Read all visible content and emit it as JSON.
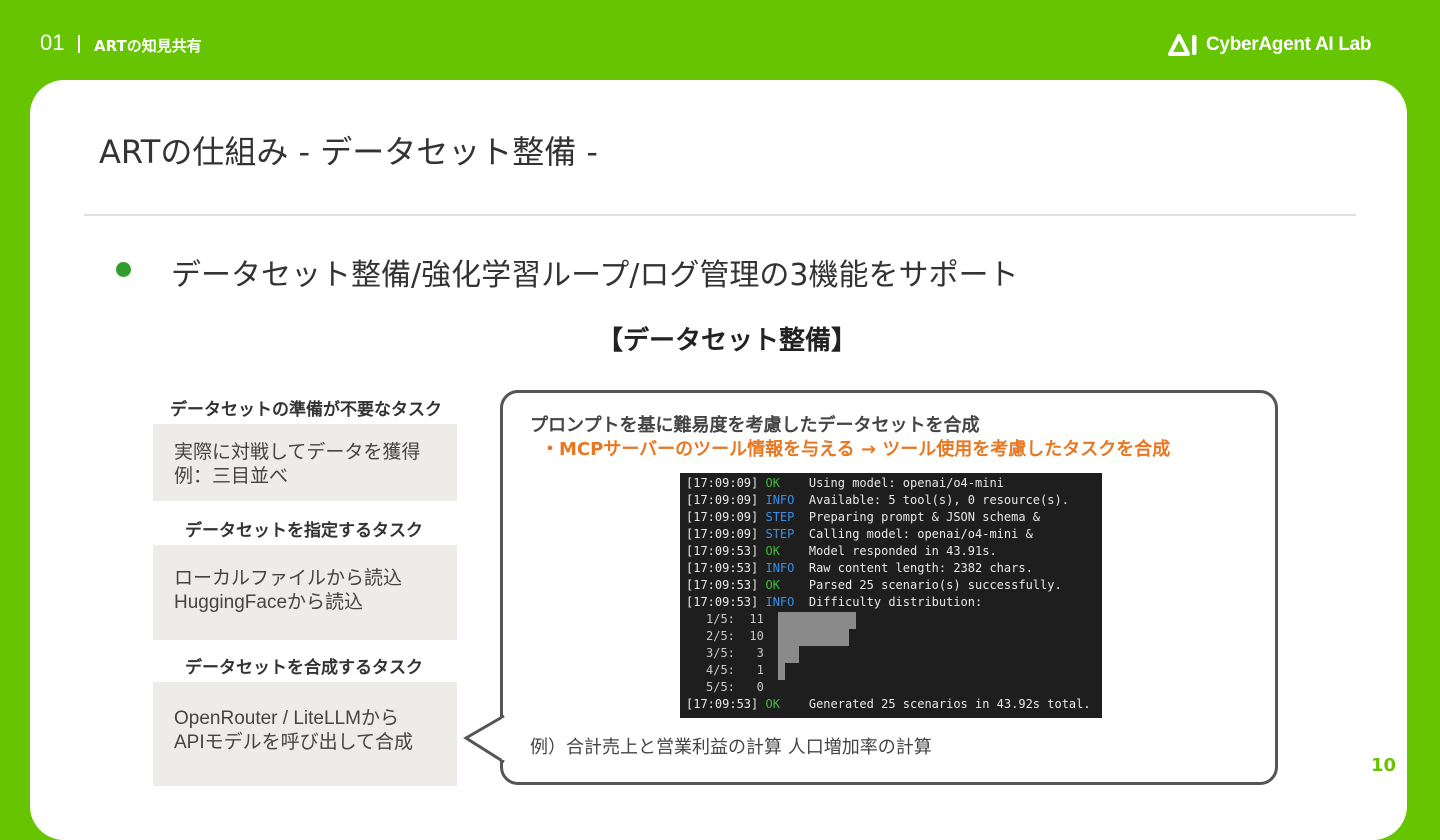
{
  "header": {
    "section_number": "01",
    "section_title": "ARTの知見共有",
    "logo_text": "CyberAgent AI Lab"
  },
  "slide": {
    "title": "ARTの仕組み - データセット整備 -",
    "bullet": "データセット整備/強化学習ループ/ログ管理の3機能をサポート",
    "subheading": "【データセット整備】",
    "page_number": "10"
  },
  "left_column": [
    {
      "label": "データセットの準備が不要なタスク",
      "content": "実際に対戦してデータを獲得\n例：三目並べ"
    },
    {
      "label": "データセットを指定するタスク",
      "content": "ローカルファイルから読込\nHuggingFaceから読込"
    },
    {
      "label": "データセットを合成するタスク",
      "content": "OpenRouter / LiteLLMから\nAPIモデルを呼び出して合成"
    }
  ],
  "bubble": {
    "line1": "プロンプトを基に難易度を考慮したデータセットを合成",
    "line2": "・MCPサーバーのツール情報を与える → ツール使用を考慮したタスクを合成",
    "example": "例）合計売上と営業利益の計算 人口増加率の計算"
  },
  "terminal": {
    "lines": [
      {
        "ts": "[17:09:09]",
        "level": "OK",
        "msg": "Using model: openai/o4-mini"
      },
      {
        "ts": "[17:09:09]",
        "level": "INFO",
        "msg": "Available: 5 tool(s), 0 resource(s)."
      },
      {
        "ts": "[17:09:09]",
        "level": "STEP",
        "msg": "Preparing prompt & JSON schema &"
      },
      {
        "ts": "[17:09:09]",
        "level": "STEP",
        "msg": "Calling model: openai/o4-mini &"
      },
      {
        "ts": "[17:09:53]",
        "level": "OK",
        "msg": "Model responded in 43.91s."
      },
      {
        "ts": "[17:09:53]",
        "level": "INFO",
        "msg": "Raw content length: 2382 chars."
      },
      {
        "ts": "[17:09:53]",
        "level": "OK",
        "msg": "Parsed 25 scenario(s) successfully."
      },
      {
        "ts": "[17:09:53]",
        "level": "INFO",
        "msg": "Difficulty distribution:"
      }
    ],
    "histogram": [
      {
        "label": "1/5:",
        "count": 11
      },
      {
        "label": "2/5:",
        "count": 10
      },
      {
        "label": "3/5:",
        "count": 3
      },
      {
        "label": "4/5:",
        "count": 1
      },
      {
        "label": "5/5:",
        "count": 0
      }
    ],
    "final_line": {
      "ts": "[17:09:53]",
      "level": "OK",
      "msg": "Generated 25 scenarios in 43.92s total."
    }
  },
  "colors": {
    "brand_green": "#66c400",
    "highlight_orange": "#e87722",
    "bullet_green": "#2f9e2f"
  }
}
